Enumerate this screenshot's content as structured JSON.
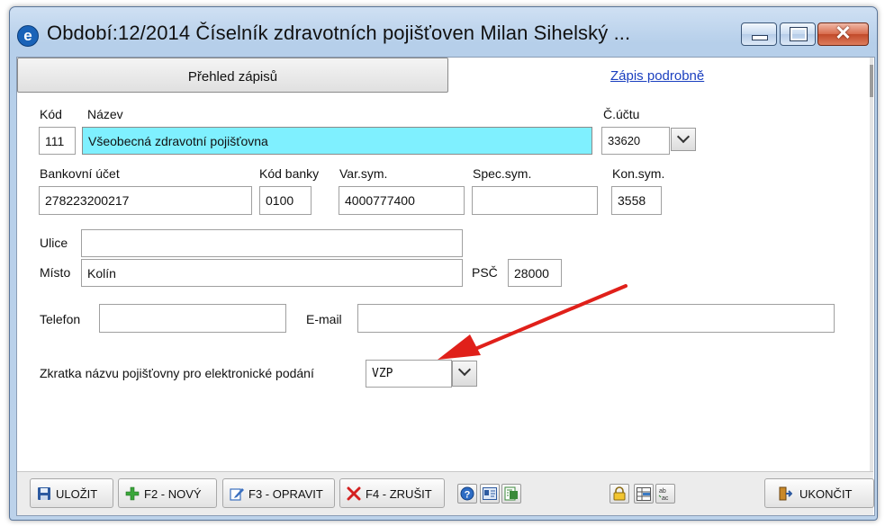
{
  "window": {
    "title": "Období:12/2014 Číselník zdravotních pojišťoven  Milan Sihelský  ...",
    "app_icon_glyph": "e"
  },
  "tabs": {
    "overview_label": "Přehled zápisů",
    "detail_label": "Zápis podrobně"
  },
  "form": {
    "kod_label": "Kód",
    "kod_value": "111",
    "nazev_label": "Název",
    "nazev_value": "Všeobecná zdravotní pojišťovna",
    "cucet_label": "Č.účtu",
    "cucet_value": "33620",
    "bankovni_ucet_label": "Bankovní účet",
    "bankovni_ucet_value": "278223200217",
    "kod_banky_label": "Kód banky",
    "kod_banky_value": "0100",
    "varsym_label": "Var.sym.",
    "varsym_value": "4000777400",
    "specsym_label": "Spec.sym.",
    "specsym_value": "",
    "konsym_label": "Kon.sym.",
    "konsym_value": "3558",
    "ulice_label": "Ulice",
    "ulice_value": "",
    "misto_label": "Místo",
    "misto_value": "Kolín",
    "psc_label": "PSČ",
    "psc_value": "28000",
    "telefon_label": "Telefon",
    "telefon_value": "",
    "email_label": "E-mail",
    "email_value": "",
    "zkratka_label": "Zkratka názvu pojišťovny pro elektronické podání",
    "zkratka_value": "VZP"
  },
  "toolbar": {
    "save_label": "ULOŽIT",
    "new_label": "F2 - NOVÝ",
    "edit_label": "F3 - OPRAVIT",
    "cancel_label": "F4 - ZRUŠIT",
    "exit_label": "UKONČIT"
  },
  "colors": {
    "highlight_field": "#7ff0ff",
    "annotation_arrow": "#e0201a",
    "link": "#1a3fbf"
  }
}
